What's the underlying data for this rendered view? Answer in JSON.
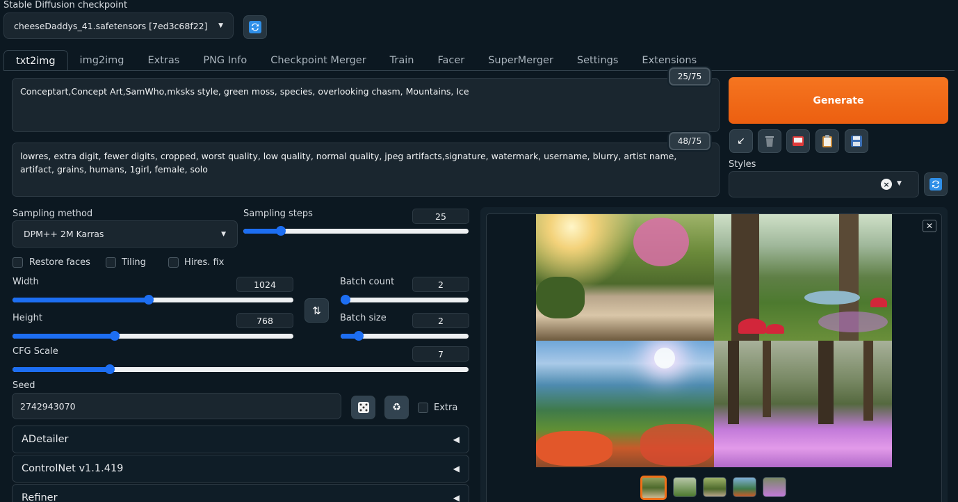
{
  "checkpoint": {
    "label": "Stable Diffusion checkpoint",
    "value": "cheeseDaddys_41.safetensors [7ed3c68f22]"
  },
  "tabs": [
    "txt2img",
    "img2img",
    "Extras",
    "PNG Info",
    "Checkpoint Merger",
    "Train",
    "Facer",
    "SuperMerger",
    "Settings",
    "Extensions"
  ],
  "prompt": {
    "text": "Conceptart,Concept Art,SamWho,mksks style, green moss, species, overlooking chasm, Mountains, Ice",
    "tokens": "25/75"
  },
  "negative_prompt": {
    "text": "lowres, extra digit, fewer digits, cropped, worst quality, low quality, normal quality, jpeg artifacts,signature, watermark, username, blurry, artist name, artifact, grains, humans, 1girl, female, solo",
    "tokens": "48/75"
  },
  "generate_label": "Generate",
  "styles_label": "Styles",
  "sampling": {
    "method_label": "Sampling method",
    "method_value": "DPM++ 2M Karras",
    "steps_label": "Sampling steps",
    "steps_value": "25",
    "steps_fraction": 0.167
  },
  "checkboxes": {
    "restore_faces": "Restore faces",
    "tiling": "Tiling",
    "hires_fix": "Hires. fix"
  },
  "width": {
    "label": "Width",
    "value": "1024",
    "fraction": 0.485
  },
  "height": {
    "label": "Height",
    "value": "768",
    "fraction": 0.364
  },
  "batch_count": {
    "label": "Batch count",
    "value": "2",
    "fraction": 0.0
  },
  "batch_size": {
    "label": "Batch size",
    "value": "2",
    "fraction": 0.143
  },
  "cfg": {
    "label": "CFG Scale",
    "value": "7",
    "fraction": 0.214
  },
  "seed": {
    "label": "Seed",
    "value": "2742943070",
    "extra_label": "Extra"
  },
  "accordions": [
    "ADetailer",
    "ControlNet v1.1.419",
    "Refiner"
  ],
  "colors": {
    "accent": "#f07018",
    "slider": "#1d6ef2",
    "background": "#0c1821"
  }
}
